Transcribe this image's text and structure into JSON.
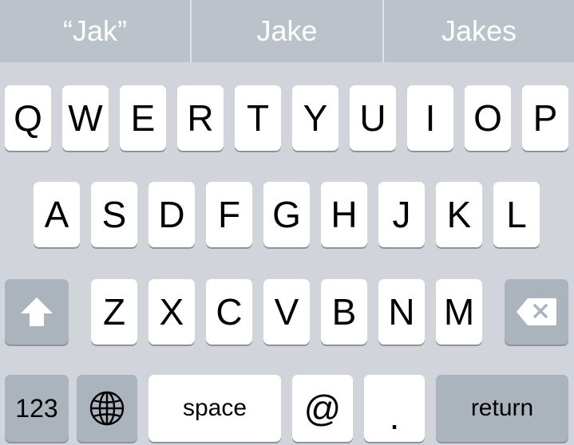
{
  "suggestions": [
    "“Jak”",
    "Jake",
    "Jakes"
  ],
  "rows": {
    "row1": [
      "Q",
      "W",
      "E",
      "R",
      "T",
      "Y",
      "U",
      "I",
      "O",
      "P"
    ],
    "row2": [
      "A",
      "S",
      "D",
      "F",
      "G",
      "H",
      "J",
      "K",
      "L"
    ],
    "row3": [
      "Z",
      "X",
      "C",
      "V",
      "B",
      "N",
      "M"
    ]
  },
  "bottom": {
    "numbers": "123",
    "space": "space",
    "at": "@",
    "period": ".",
    "return": "return"
  },
  "colors": {
    "suggestion_bar": "#bbc2ca",
    "keyboard_bg": "#d1d5db",
    "key": "#ffffff",
    "special_key": "#abb3bd"
  }
}
